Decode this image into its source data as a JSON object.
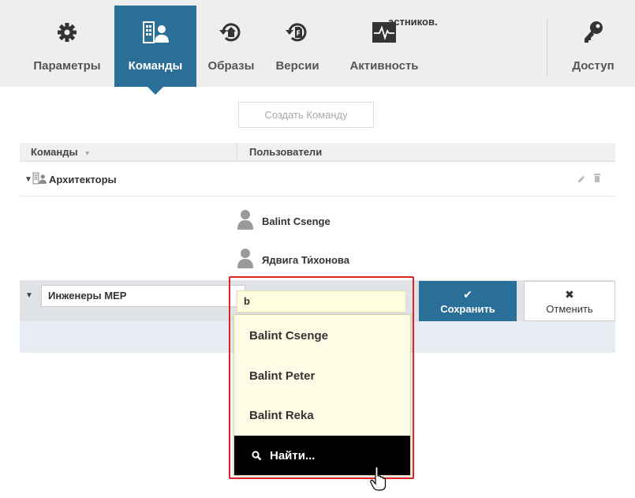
{
  "nav": {
    "tabs": [
      {
        "label": "Параметры",
        "icon": "gear-icon"
      },
      {
        "label": "Команды",
        "icon": "team-icon",
        "active": true
      },
      {
        "label": "Образы",
        "icon": "image-history-icon"
      },
      {
        "label": "Версии",
        "icon": "version-history-icon"
      },
      {
        "label": "Активность",
        "icon": "activity-icon"
      },
      {
        "label": "Доступ",
        "icon": "key-icon"
      }
    ]
  },
  "create_button": "Создать Команду",
  "table": {
    "col_teams": "Команды",
    "col_users": "Пользователи"
  },
  "group": {
    "name": "Архитекторы",
    "members": [
      "Balint Csenge",
      "Ядвига Ти́хонова"
    ]
  },
  "edit": {
    "team_name_value": "Инженеры MEP",
    "search_value": "b",
    "hint_partial": "астников.",
    "save_label": "Сохранить",
    "cancel_label": "Отменить"
  },
  "dropdown": {
    "options": [
      "Balint Csenge",
      "Balint Peter",
      "Balint Reka"
    ],
    "find_label": "Найти..."
  },
  "colors": {
    "accent": "#2a6f97",
    "highlight_border": "#e02424",
    "dropdown_bg": "#fffce6"
  }
}
